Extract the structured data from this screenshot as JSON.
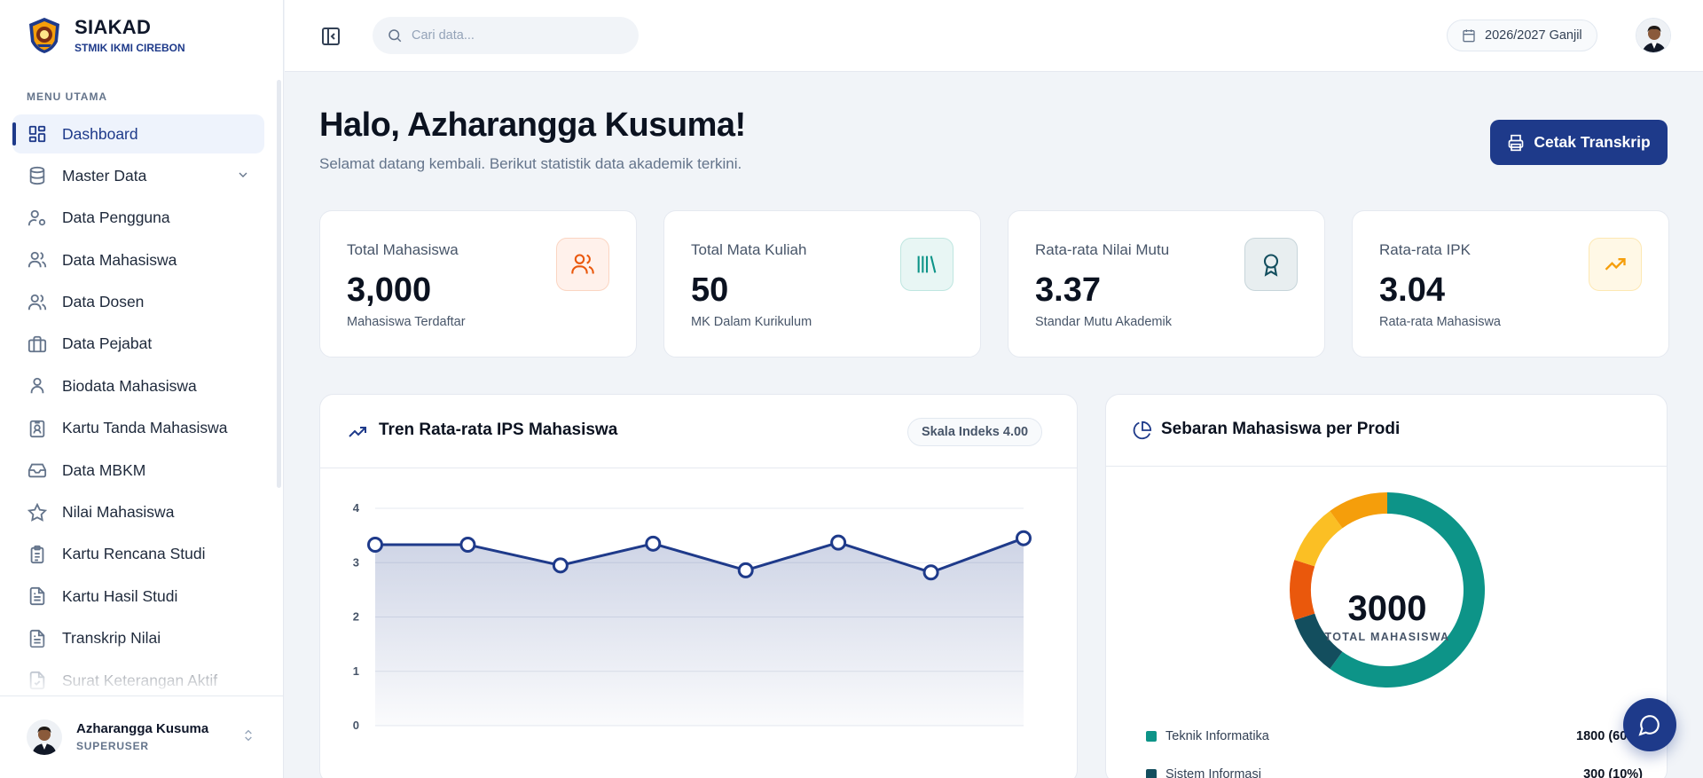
{
  "brand": {
    "title": "SIAKAD",
    "subtitle": "STMIK IKMI CIREBON"
  },
  "sidebar": {
    "heading": "MENU UTAMA",
    "items": [
      {
        "label": "Dashboard",
        "icon": "dashboard-icon",
        "active": true
      },
      {
        "label": "Master Data",
        "icon": "database-icon",
        "expandable": true
      },
      {
        "label": "Data Pengguna",
        "icon": "user-cog-icon"
      },
      {
        "label": "Data Mahasiswa",
        "icon": "users-icon"
      },
      {
        "label": "Data Dosen",
        "icon": "users-icon"
      },
      {
        "label": "Data Pejabat",
        "icon": "briefcase-icon"
      },
      {
        "label": "Biodata Mahasiswa",
        "icon": "user-icon"
      },
      {
        "label": "Kartu Tanda Mahasiswa",
        "icon": "id-card-icon"
      },
      {
        "label": "Data MBKM",
        "icon": "inbox-icon"
      },
      {
        "label": "Nilai Mahasiswa",
        "icon": "star-icon"
      },
      {
        "label": "Kartu Rencana Studi",
        "icon": "clipboard-icon"
      },
      {
        "label": "Kartu Hasil Studi",
        "icon": "file-text-icon"
      },
      {
        "label": "Transkrip Nilai",
        "icon": "file-text-icon"
      },
      {
        "label": "Surat Keterangan Aktif",
        "icon": "file-check-icon"
      }
    ],
    "user": {
      "name": "Azharangga Kusuma",
      "role": "SUPERUSER"
    }
  },
  "topbar": {
    "search_placeholder": "Cari data...",
    "period": "2026/2027 Ganjil"
  },
  "main": {
    "greeting": "Halo, Azharangga Kusuma!",
    "subtitle": "Selamat datang kembali. Berikut statistik data akademik terkini.",
    "print_button": "Cetak Transkrip"
  },
  "stats": [
    {
      "label": "Total Mahasiswa",
      "value": "3,000",
      "note": "Mahasiswa Terdaftar",
      "icon": "users-icon",
      "color": "#ea580c",
      "bg": "#fff1eb"
    },
    {
      "label": "Total Mata Kuliah",
      "value": "50",
      "note": "MK Dalam Kurikulum",
      "icon": "library-icon",
      "color": "#0d9488",
      "bg": "#e8f6f4"
    },
    {
      "label": "Rata-rata Nilai Mutu",
      "value": "3.37",
      "note": "Standar Mutu Akademik",
      "icon": "award-icon",
      "color": "#134e5e",
      "bg": "#e8eef0"
    },
    {
      "label": "Rata-rata IPK",
      "value": "3.04",
      "note": "Rata-rata Mahasiswa",
      "icon": "trending-up-icon",
      "color": "#f59e0b",
      "bg": "#fff8e6"
    }
  ],
  "trend_card": {
    "title": "Tren Rata-rata IPS Mahasiswa",
    "badge": "Skala Indeks 4.00"
  },
  "donut_card": {
    "title": "Sebaran Mahasiswa per Prodi",
    "center_value": "3000",
    "center_label": "TOTAL MAHASISWA"
  },
  "chart_data": [
    {
      "type": "area",
      "title": "Tren Rata-rata IPS Mahasiswa",
      "ylim": [
        0,
        4
      ],
      "yticks": [
        0,
        1,
        2,
        3,
        4
      ],
      "values": [
        3.33,
        3.33,
        2.95,
        3.35,
        2.86,
        3.37,
        2.82,
        3.45
      ],
      "color": "#1e3a8a",
      "grid": true
    },
    {
      "type": "pie",
      "title": "Sebaran Mahasiswa per Prodi",
      "total": 3000,
      "slices": [
        {
          "name": "Teknik Informatika",
          "value": 1800,
          "label": "1800 (60%)",
          "color": "#0d9488"
        },
        {
          "name": "Sistem Informasi",
          "value": 300,
          "label": "300 (10%)",
          "color": "#134e5e"
        },
        {
          "name": "",
          "value": 300,
          "color": "#ea580c"
        },
        {
          "name": "",
          "value": 300,
          "color": "#fbbf24"
        },
        {
          "name": "",
          "value": 300,
          "color": "#f59e0b"
        }
      ]
    }
  ]
}
